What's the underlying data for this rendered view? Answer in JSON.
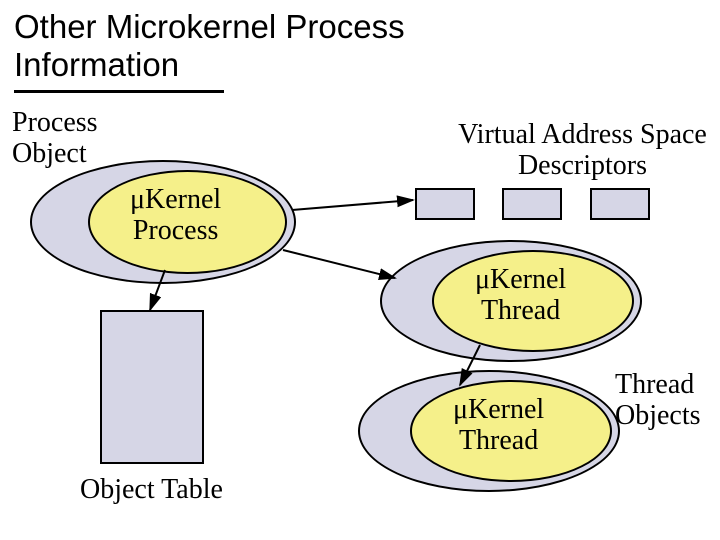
{
  "title_line1": "Other Microkernel Process",
  "title_line2": "Information",
  "labels": {
    "process_object": "Process",
    "process_object2": "Object",
    "kernel_process1": "μKernel",
    "kernel_process2": "Process",
    "vas1": "Virtual Address Space",
    "vas2": "Descriptors",
    "kernel_thread_a1": "μKernel",
    "kernel_thread_a2": "Thread",
    "kernel_thread_b1": "μKernel",
    "kernel_thread_b2": "Thread",
    "thread_objects1": "Thread",
    "thread_objects2": "Objects",
    "object_table": "Object Table"
  }
}
